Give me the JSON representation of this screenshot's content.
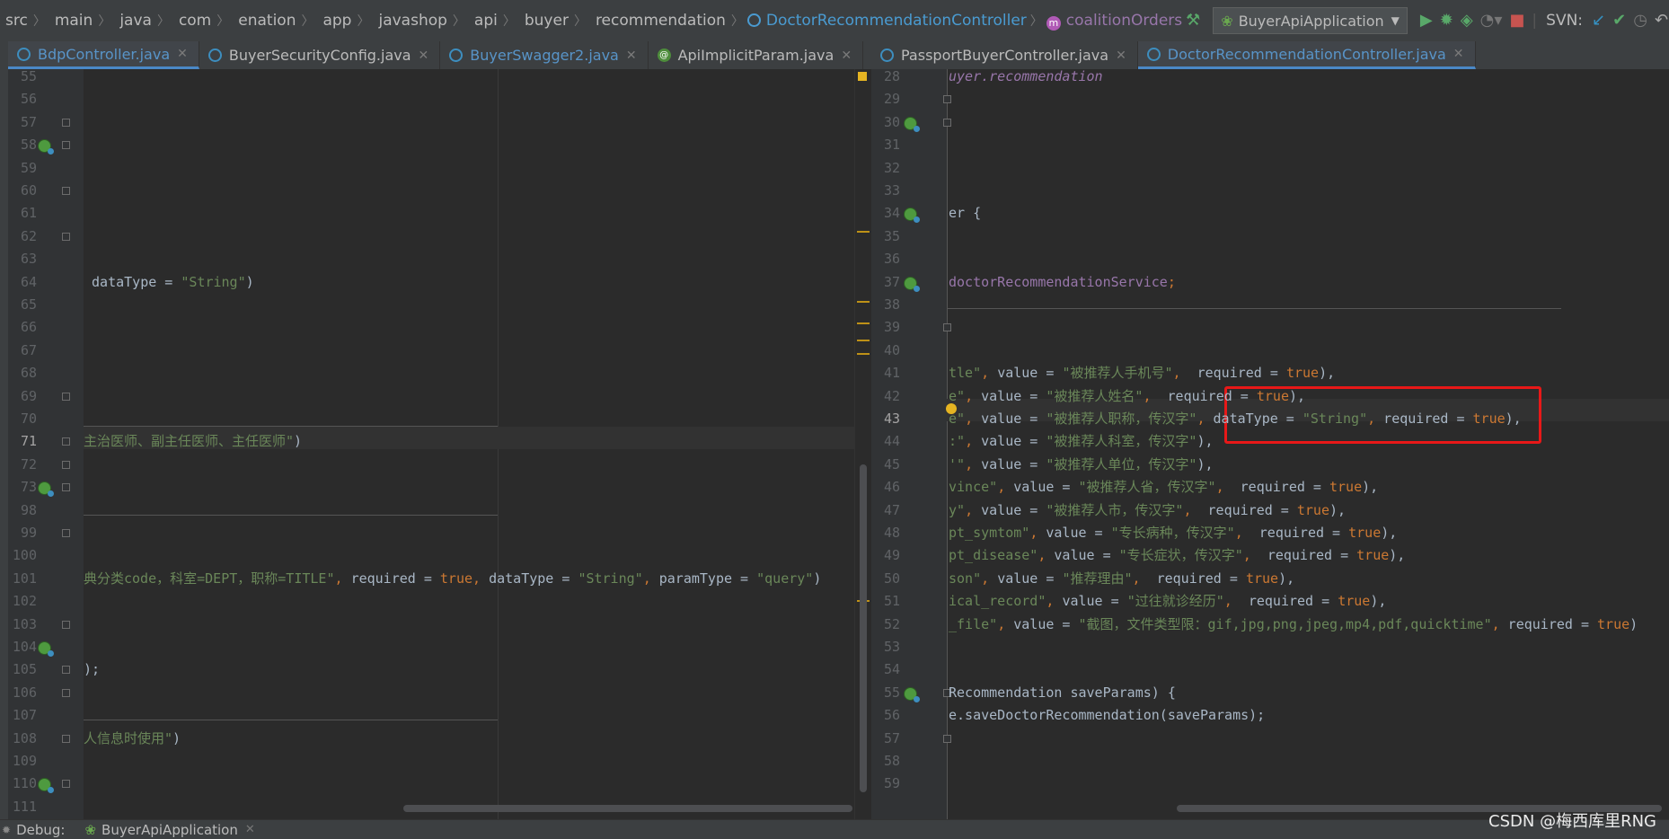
{
  "breadcrumb": [
    "src",
    "main",
    "java",
    "com",
    "enation",
    "app",
    "javashop",
    "api",
    "buyer",
    "recommendation"
  ],
  "breadcrumb_class": "DoctorRecommendationController",
  "breadcrumb_method": "coalitionOrders",
  "run_config": "BuyerApiApplication",
  "svn_label": "SVN:",
  "left_tabs": [
    {
      "label": "BdpController.java",
      "active": true
    },
    {
      "label": "BuyerSecurityConfig.java",
      "active": false
    },
    {
      "label": "BuyerSwagger2.java",
      "active": false
    },
    {
      "label": "ApiImplicitParam.java",
      "active": false
    }
  ],
  "right_tabs": [
    {
      "label": "PassportBuyerController.java",
      "active": false
    },
    {
      "label": "DoctorRecommendationController.java",
      "active": true
    }
  ],
  "left_lines": [
    {
      "n": "55"
    },
    {
      "n": "56"
    },
    {
      "n": "57"
    },
    {
      "n": "58"
    },
    {
      "n": "59"
    },
    {
      "n": "60"
    },
    {
      "n": "61"
    },
    {
      "n": "62"
    },
    {
      "n": "63"
    },
    {
      "n": "64",
      "code": [
        [
          "plain",
          " dataType = "
        ],
        [
          "str",
          "\"String\""
        ],
        [
          "plain",
          ")"
        ]
      ]
    },
    {
      "n": "65"
    },
    {
      "n": "66"
    },
    {
      "n": "67"
    },
    {
      "n": "68"
    },
    {
      "n": "69"
    },
    {
      "n": "70"
    },
    {
      "n": "71",
      "code": [
        [
          "str",
          "主治医师、副主任医师、主任医师\""
        ],
        [
          "plain",
          ")"
        ]
      ]
    },
    {
      "n": "72"
    },
    {
      "n": "73"
    },
    {
      "n": "98"
    },
    {
      "n": "99"
    },
    {
      "n": "100"
    },
    {
      "n": "101",
      "code": [
        [
          "str",
          "典分类code，科室=DEPT，职称=TITLE\""
        ],
        [
          "kw",
          ", "
        ],
        [
          "plain",
          "required = "
        ],
        [
          "kw",
          "true, "
        ],
        [
          "plain",
          "dataType = "
        ],
        [
          "str",
          "\"String\""
        ],
        [
          "kw",
          ", "
        ],
        [
          "plain",
          "paramType = "
        ],
        [
          "str",
          "\"query\""
        ],
        [
          "plain",
          ")"
        ]
      ]
    },
    {
      "n": "102"
    },
    {
      "n": "103"
    },
    {
      "n": "104"
    },
    {
      "n": "105",
      "code": [
        [
          "plain",
          ");"
        ]
      ]
    },
    {
      "n": "106"
    },
    {
      "n": "107"
    },
    {
      "n": "108",
      "code": [
        [
          "str",
          "人信息时使用\""
        ],
        [
          "plain",
          ")"
        ]
      ]
    },
    {
      "n": "109"
    },
    {
      "n": "110"
    },
    {
      "n": "111"
    }
  ],
  "right_lines": [
    {
      "n": "28",
      "code": [
        [
          "field",
          "uyer.recommendation"
        ]
      ]
    },
    {
      "n": "29"
    },
    {
      "n": "30"
    },
    {
      "n": "31"
    },
    {
      "n": "32"
    },
    {
      "n": "33"
    },
    {
      "n": "34",
      "code": [
        [
          "plain",
          "er {"
        ]
      ]
    },
    {
      "n": "35"
    },
    {
      "n": "36"
    },
    {
      "n": "37",
      "code": [
        [
          "fieldn",
          "doctorRecommendationService"
        ],
        [
          "kw",
          ";"
        ]
      ]
    },
    {
      "n": "38"
    },
    {
      "n": "39"
    },
    {
      "n": "40"
    },
    {
      "n": "41",
      "code": [
        [
          "str",
          "tle\""
        ],
        [
          "kw",
          ", "
        ],
        [
          "plain",
          "value = "
        ],
        [
          "str",
          "\"被推荐人手机号\""
        ],
        [
          "kw",
          ",  "
        ],
        [
          "plain",
          "required = "
        ],
        [
          "kw",
          "true"
        ],
        [
          "plain",
          "),"
        ]
      ]
    },
    {
      "n": "42",
      "code": [
        [
          "str",
          "e\""
        ],
        [
          "kw",
          ", "
        ],
        [
          "plain",
          "value = "
        ],
        [
          "str",
          "\"被推荐人姓名\""
        ],
        [
          "kw",
          ",  "
        ],
        [
          "plain",
          "required = "
        ],
        [
          "kw",
          "true"
        ],
        [
          "plain",
          "),"
        ]
      ]
    },
    {
      "n": "43",
      "code": [
        [
          "str",
          "e\""
        ],
        [
          "kw",
          ", "
        ],
        [
          "plain",
          "value = "
        ],
        [
          "str",
          "\"被推荐人职称，传汉字\""
        ],
        [
          "kw",
          ", "
        ],
        [
          "plain",
          "dataType = "
        ],
        [
          "str",
          "\"String\""
        ],
        [
          "kw",
          ", "
        ],
        [
          "plain",
          "required = "
        ],
        [
          "kw",
          "true"
        ],
        [
          "plain",
          "),"
        ]
      ]
    },
    {
      "n": "44",
      "code": [
        [
          "str",
          ":\""
        ],
        [
          "kw",
          ", "
        ],
        [
          "plain",
          "value = "
        ],
        [
          "str",
          "\"被推荐人科室，传汉字\""
        ],
        [
          "plain",
          "),"
        ]
      ]
    },
    {
      "n": "45",
      "code": [
        [
          "str",
          "'\""
        ],
        [
          "kw",
          ", "
        ],
        [
          "plain",
          "value = "
        ],
        [
          "str",
          "\"被推荐人单位，传汉字\""
        ],
        [
          "plain",
          "),"
        ]
      ]
    },
    {
      "n": "46",
      "code": [
        [
          "str",
          "vince\""
        ],
        [
          "kw",
          ", "
        ],
        [
          "plain",
          "value = "
        ],
        [
          "str",
          "\"被推荐人省，传汉字\""
        ],
        [
          "kw",
          ",  "
        ],
        [
          "plain",
          "required = "
        ],
        [
          "kw",
          "true"
        ],
        [
          "plain",
          "),"
        ]
      ]
    },
    {
      "n": "47",
      "code": [
        [
          "str",
          "y\""
        ],
        [
          "kw",
          ", "
        ],
        [
          "plain",
          "value = "
        ],
        [
          "str",
          "\"被推荐人市，传汉字\""
        ],
        [
          "kw",
          ",  "
        ],
        [
          "plain",
          "required = "
        ],
        [
          "kw",
          "true"
        ],
        [
          "plain",
          "),"
        ]
      ]
    },
    {
      "n": "48",
      "code": [
        [
          "str",
          "pt_symtom\""
        ],
        [
          "kw",
          ", "
        ],
        [
          "plain",
          "value = "
        ],
        [
          "str",
          "\"专长病种，传汉字\""
        ],
        [
          "kw",
          ",  "
        ],
        [
          "plain",
          "required = "
        ],
        [
          "kw",
          "true"
        ],
        [
          "plain",
          "),"
        ]
      ]
    },
    {
      "n": "49",
      "code": [
        [
          "str",
          "pt_disease\""
        ],
        [
          "kw",
          ", "
        ],
        [
          "plain",
          "value = "
        ],
        [
          "str",
          "\"专长症状，传汉字\""
        ],
        [
          "kw",
          ",  "
        ],
        [
          "plain",
          "required = "
        ],
        [
          "kw",
          "true"
        ],
        [
          "plain",
          "),"
        ]
      ]
    },
    {
      "n": "50",
      "code": [
        [
          "str",
          "son\""
        ],
        [
          "kw",
          ", "
        ],
        [
          "plain",
          "value = "
        ],
        [
          "str",
          "\"推荐理由\""
        ],
        [
          "kw",
          ",  "
        ],
        [
          "plain",
          "required = "
        ],
        [
          "kw",
          "true"
        ],
        [
          "plain",
          "),"
        ]
      ]
    },
    {
      "n": "51",
      "code": [
        [
          "str",
          "ical_record\""
        ],
        [
          "kw",
          ", "
        ],
        [
          "plain",
          "value = "
        ],
        [
          "str",
          "\"过往就诊经历\""
        ],
        [
          "kw",
          ",  "
        ],
        [
          "plain",
          "required = "
        ],
        [
          "kw",
          "true"
        ],
        [
          "plain",
          "),"
        ]
      ]
    },
    {
      "n": "52",
      "code": [
        [
          "str",
          "_file\""
        ],
        [
          "kw",
          ", "
        ],
        [
          "plain",
          "value = "
        ],
        [
          "str",
          "\"截图，文件类型限：gif,jpg,png,jpeg,mp4,pdf,quicktime\""
        ],
        [
          "kw",
          ", "
        ],
        [
          "plain",
          "required = "
        ],
        [
          "kw",
          "true"
        ],
        [
          "plain",
          ")"
        ]
      ]
    },
    {
      "n": "53"
    },
    {
      "n": "54"
    },
    {
      "n": "55",
      "code": [
        [
          "plain",
          "Recommendation saveParams) {"
        ]
      ]
    },
    {
      "n": "56",
      "code": [
        [
          "plain",
          "e.saveDoctorRecommendation(saveParams);"
        ]
      ]
    },
    {
      "n": "57"
    },
    {
      "n": "58"
    },
    {
      "n": "59"
    }
  ],
  "debug_label": "Debug:",
  "debug_config": "BuyerApiApplication",
  "watermark": "CSDN @梅西库里RNG"
}
